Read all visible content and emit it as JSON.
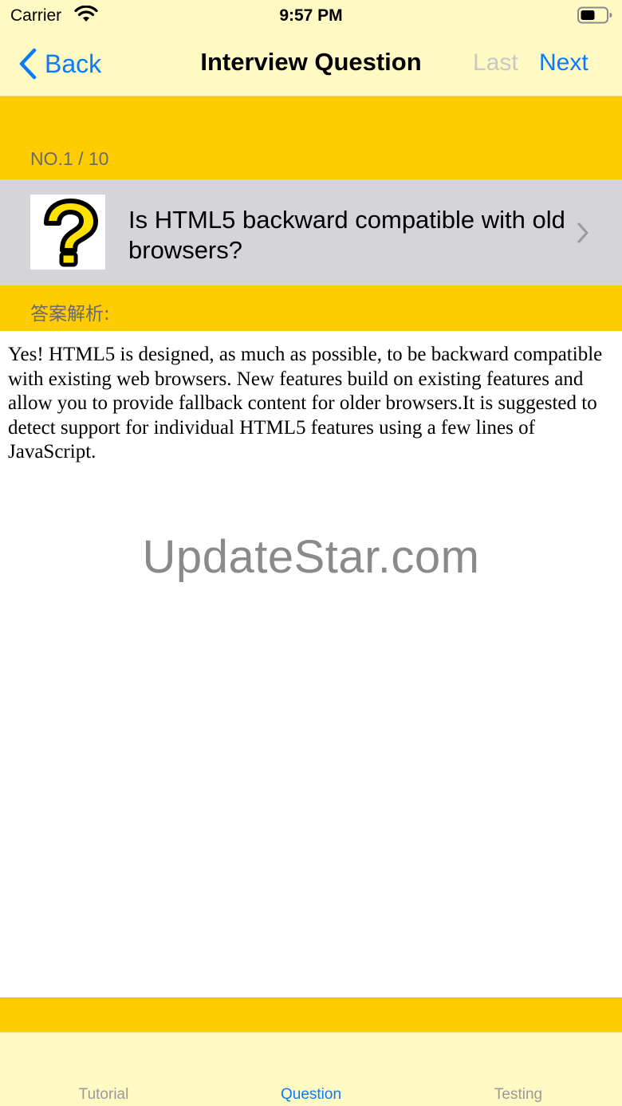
{
  "status_bar": {
    "carrier": "Carrier",
    "time": "9:57 PM"
  },
  "nav": {
    "back_label": "Back",
    "title": "Interview Question",
    "last_label": "Last",
    "next_label": "Next",
    "accent_color": "#0a7bff",
    "disabled_color": "#c8c8c8"
  },
  "question": {
    "number": "NO.1 / 10",
    "text": "Is HTML5 backward compatible with old browsers?",
    "icon": "question-mark-icon"
  },
  "answer": {
    "label": "答案解析:",
    "text": "Yes! HTML5 is designed, as much as possible, to be backward compatible with existing web browsers. New features build on existing features and allow you to provide fallback content for older browsers.It is suggested to detect support for individual HTML5 features using a few lines of JavaScript."
  },
  "watermark": "UpdateStar.com",
  "tabs": [
    {
      "label": "Tutorial",
      "active": false
    },
    {
      "label": "Question",
      "active": true
    },
    {
      "label": "Testing",
      "active": false
    }
  ],
  "colors": {
    "bar_background": "#fff9c4",
    "highlight_yellow": "#ffcc00",
    "row_gray": "#d5d4d8"
  }
}
